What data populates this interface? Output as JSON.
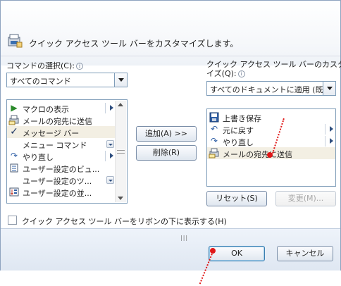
{
  "header": {
    "title": "クイック アクセス ツール バーをカスタマイズします。",
    "icon": "customize-toolbar-icon"
  },
  "left": {
    "label": "コマンドの選択(C):",
    "combo_value": "すべてのコマンド",
    "items": [
      {
        "label": "マクロの表示",
        "icon": "play-icon",
        "has_submenu": true,
        "has_dropdown": false
      },
      {
        "label": "メールの宛先に送信",
        "icon": "mail-printer-icon",
        "has_submenu": false,
        "has_dropdown": false
      },
      {
        "label": "メッセージ バー",
        "icon": "checkmark-icon",
        "has_submenu": false,
        "has_dropdown": false,
        "selected": true
      },
      {
        "label": "メニュー コマンド",
        "icon": "",
        "has_submenu": false,
        "has_dropdown": true
      },
      {
        "label": "やり直し",
        "icon": "redo-icon",
        "has_submenu": true,
        "has_dropdown": false
      },
      {
        "label": "ユーザー設定のビュ...",
        "icon": "custom-view-icon",
        "has_submenu": false,
        "has_dropdown": false
      },
      {
        "label": "ユーザー設定のツ...",
        "icon": "",
        "has_submenu": false,
        "has_dropdown": true
      },
      {
        "label": "ユーザー設定の並...",
        "icon": "custom-sort-icon",
        "has_submenu": false,
        "has_dropdown": false
      }
    ]
  },
  "buttons": {
    "add": "追加(A) >>",
    "remove": "削除(R)",
    "reset": "リセット(S)",
    "modify": "変更(M)...",
    "ok": "OK",
    "cancel": "キャンセル"
  },
  "right": {
    "label_line1": "クイック アクセス ツール バーのカスタマ",
    "label_line2": "イズ(Q):",
    "combo_value": "すべてのドキュメントに適用 (既...",
    "items": [
      {
        "label": "上書き保存",
        "icon": "save-icon",
        "has_submenu": false
      },
      {
        "label": "元に戻す",
        "icon": "undo-icon",
        "has_submenu": true
      },
      {
        "label": "やり直し",
        "icon": "redo-icon",
        "has_submenu": true
      },
      {
        "label": "メールの宛先に送信",
        "icon": "mail-printer-icon",
        "has_submenu": false,
        "selected": true
      }
    ]
  },
  "checkbox": {
    "label": "クイック アクセス ツール バーをリボンの下に表示する(H)",
    "checked": false
  },
  "colors": {
    "annotation": "#e01818",
    "selection": "#f3efe3",
    "border": "#7f9db9"
  }
}
